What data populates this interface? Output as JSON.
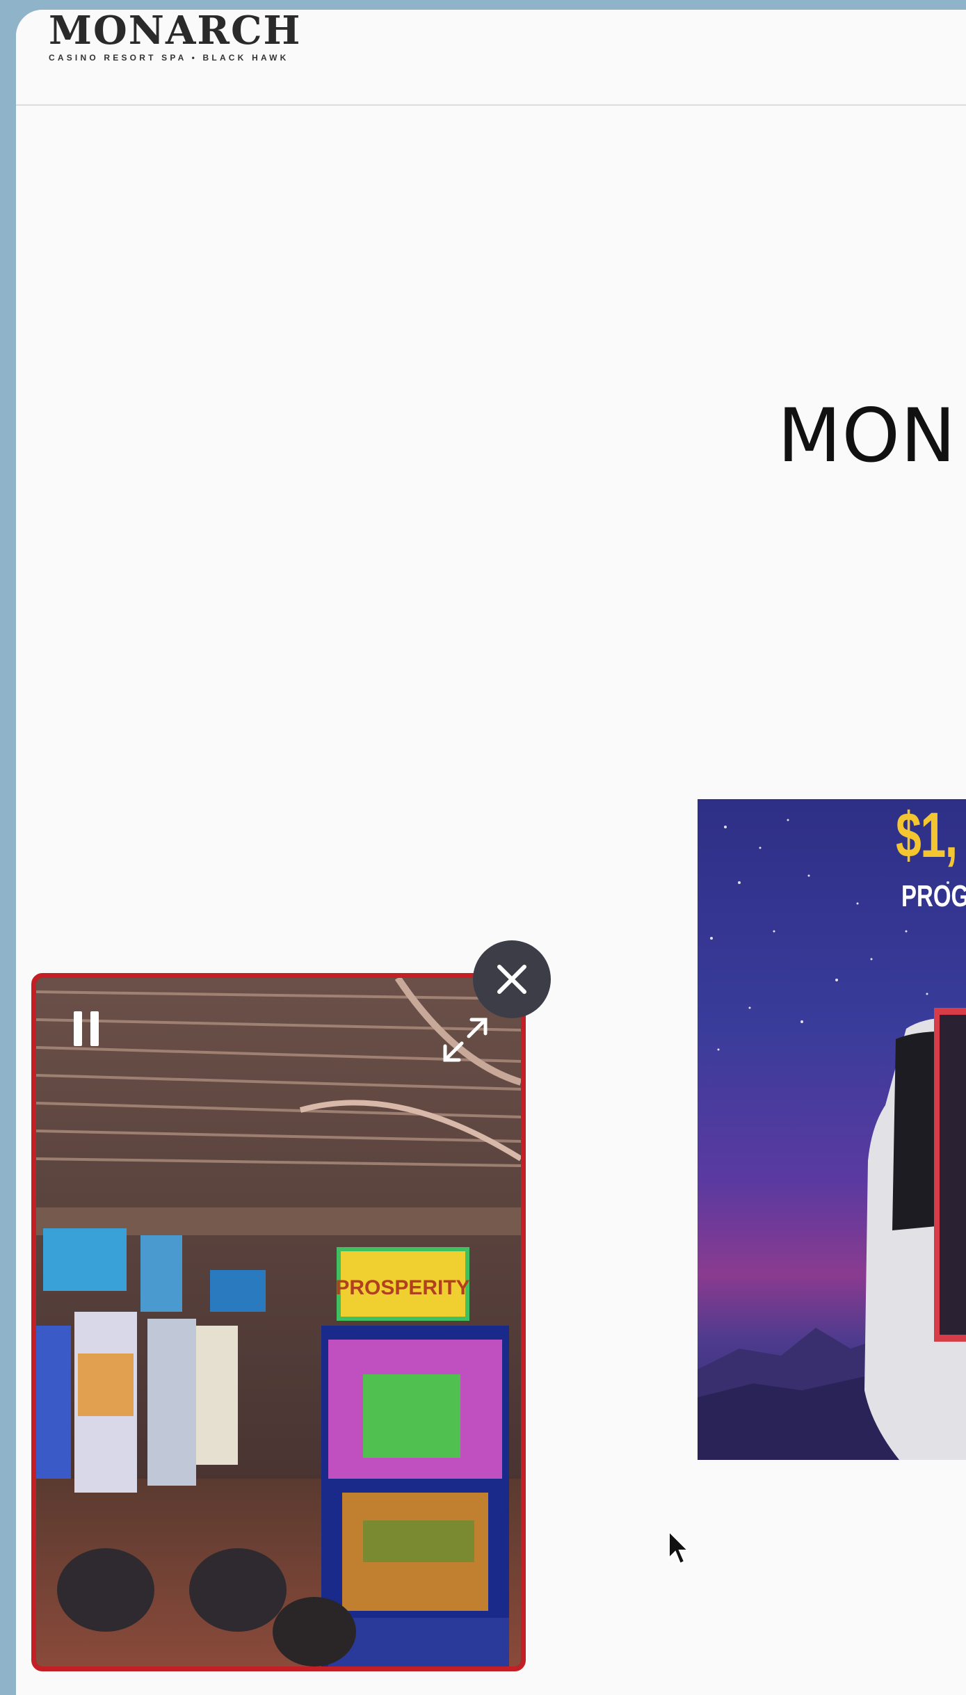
{
  "header": {
    "logo_word": "MONARCH",
    "logo_tagline": "CASINO RESORT SPA • BLACK HAWK"
  },
  "hero": {
    "title_partial": "MON"
  },
  "promo": {
    "amount_partial": "$1,",
    "subtitle_partial": "PROG"
  },
  "video": {
    "pause_icon": "pause-icon",
    "expand_icon": "expand-icon",
    "close_icon": "close-icon",
    "machine_sign": "PROSPERITY"
  },
  "colors": {
    "card_border": "#c41f25",
    "promo_gold": "#f3c531",
    "close_bg": "#3d3d48"
  }
}
